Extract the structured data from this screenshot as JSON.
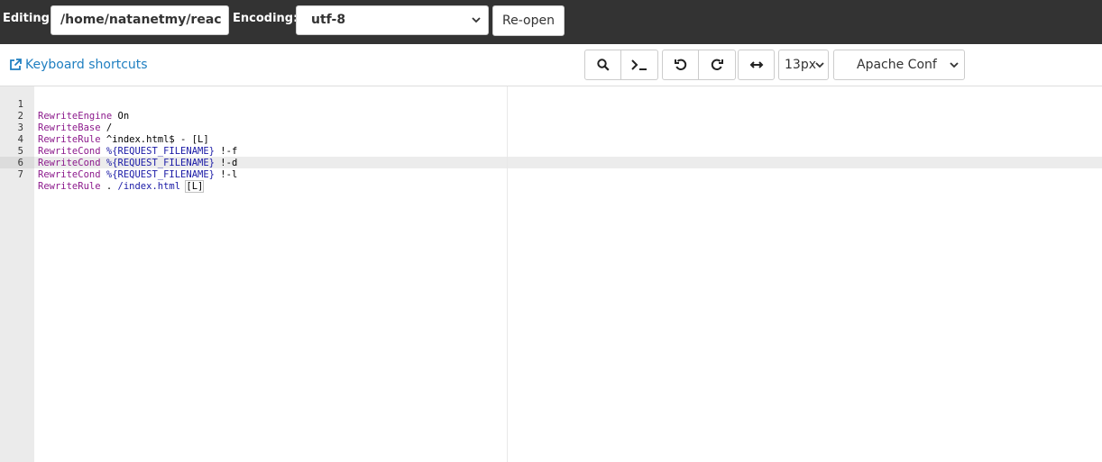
{
  "topbar": {
    "editing_label": "Editing:",
    "path_value": "/home/natanetmy/reac",
    "encoding_label": "Encoding:",
    "encoding_value": "utf-8",
    "reopen_label": "Re-open"
  },
  "toolbar": {
    "keyboard_shortcuts_label": "Keyboard shortcuts",
    "font_size_value": "13px",
    "mode_value": "Apache Conf",
    "icons": [
      "search-icon",
      "terminal-icon",
      "undo-icon",
      "redo-icon",
      "wrap-icon"
    ]
  },
  "editor": {
    "lines": [
      {
        "num": "1",
        "kw": "RewriteEngine",
        "rest": " On"
      },
      {
        "num": "2",
        "kw": "RewriteBase",
        "rest": " /"
      },
      {
        "num": "3",
        "kw": "RewriteRule",
        "rest": " ^index.html$ - [L]"
      },
      {
        "num": "4",
        "kw": "RewriteCond",
        "var": "%{REQUEST_FILENAME}",
        "rest": " !-f"
      },
      {
        "num": "5",
        "kw": "RewriteCond",
        "var": "%{REQUEST_FILENAME}",
        "rest": " !-d"
      },
      {
        "num": "6",
        "kw": "RewriteCond",
        "var": "%{REQUEST_FILENAME}",
        "rest": " !-l"
      },
      {
        "num": "7",
        "kw": "RewriteRule",
        "rest": " . ",
        "path": "/index.html",
        "tail": "[L]"
      }
    ],
    "active_line": 7
  },
  "colors": {
    "topbar_bg": "#333333",
    "link": "#1f7fc1",
    "keyword": "#8c1a8c",
    "variable": "#1a1aa6"
  }
}
